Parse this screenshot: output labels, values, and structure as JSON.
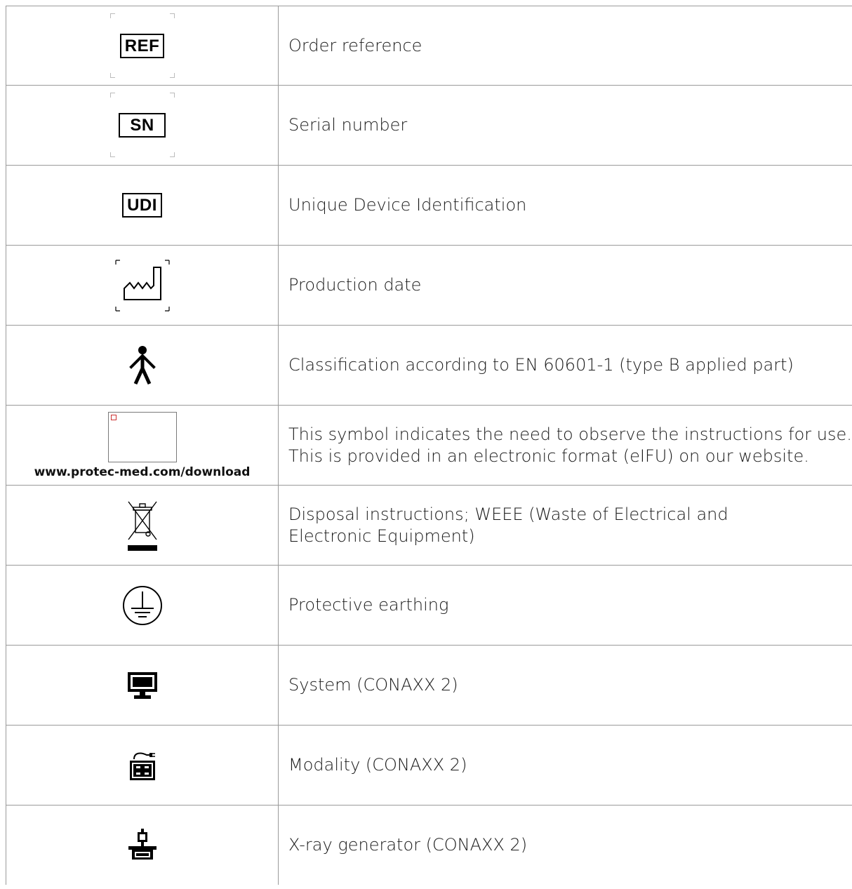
{
  "rows": [
    {
      "symbol": "ref-symbol",
      "symbol_text": "REF",
      "description": "Order reference"
    },
    {
      "symbol": "sn-symbol",
      "symbol_text": "SN",
      "description": "Serial number"
    },
    {
      "symbol": "udi-symbol",
      "symbol_text": "UDI",
      "description": "Unique Device Identification"
    },
    {
      "symbol": "production-date-icon",
      "description": "Production date"
    },
    {
      "symbol": "type-b-applied-part-icon",
      "description": "Classification according to EN 60601-1 (type B applied part)"
    },
    {
      "symbol": "eifu-icon",
      "symbol_caption": "www.protec-med.com/download",
      "description_lines": [
        "This symbol indicates the need to observe the instructions for use.",
        "This is provided in an electronic format (eIFU) on our website."
      ]
    },
    {
      "symbol": "weee-icon",
      "description": "Disposal instructions; WEEE (Waste of Electrical and Electronic Equipment)"
    },
    {
      "symbol": "protective-earth-icon",
      "description": "Protective earthing"
    },
    {
      "symbol": "system-monitor-icon",
      "description": "System (CONAXX 2)"
    },
    {
      "symbol": "modality-icon",
      "description": "Modality (CONAXX 2)"
    },
    {
      "symbol": "xray-generator-icon",
      "description": "X-ray generator (CONAXX 2)"
    }
  ]
}
